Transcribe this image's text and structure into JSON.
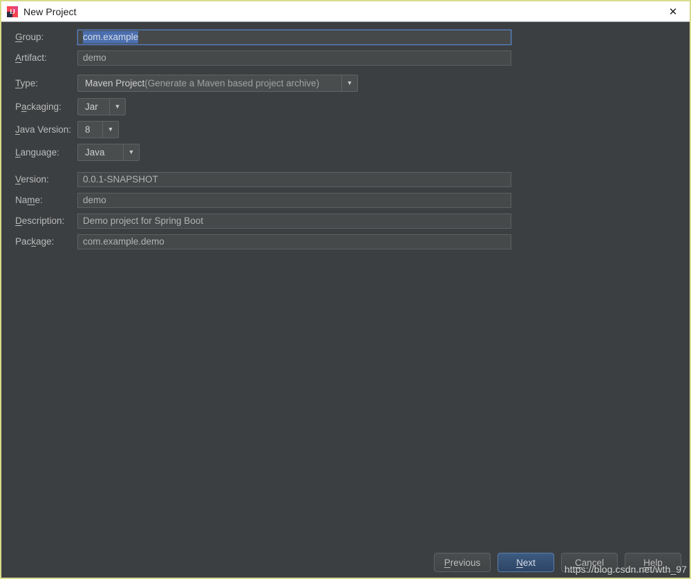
{
  "window": {
    "title": "New Project",
    "icon": "intellij-idea-icon",
    "close_label": "✕",
    "accent_border": "#d9dc8a",
    "panel_bg": "#3c3f41",
    "selection_color": "#4b6eaf",
    "focus_border": "#5781c4"
  },
  "form": {
    "fields": [
      {
        "name": "group",
        "label_pre": "",
        "label_mnemonic": "G",
        "label_post": "roup:",
        "kind": "text",
        "value": "com.example",
        "selected": true,
        "focused": true
      },
      {
        "name": "artifact",
        "label_pre": "",
        "label_mnemonic": "A",
        "label_post": "rtifact:",
        "kind": "text",
        "value": "demo",
        "selected": false,
        "focused": false
      },
      {
        "name": "type",
        "label_pre": "",
        "label_mnemonic": "T",
        "label_post": "ype:",
        "kind": "combo",
        "value": "Maven Project",
        "value_dim": " (Generate a Maven based project archive)",
        "arrow": "▼"
      },
      {
        "name": "packaging",
        "label_pre": "P",
        "label_mnemonic": "a",
        "label_post": "ckaging:",
        "kind": "combo",
        "value": "Jar",
        "value_dim": "",
        "arrow": "▼"
      },
      {
        "name": "java-version",
        "label_pre": "",
        "label_mnemonic": "J",
        "label_post": "ava Version:",
        "kind": "combo",
        "value": "8",
        "value_dim": "",
        "arrow": "▼"
      },
      {
        "name": "language",
        "label_pre": "",
        "label_mnemonic": "L",
        "label_post": "anguage:",
        "kind": "combo",
        "value": "Java",
        "value_dim": "",
        "arrow": "▼"
      },
      {
        "name": "version",
        "label_pre": "",
        "label_mnemonic": "V",
        "label_post": "ersion:",
        "kind": "text",
        "value": "0.0.1-SNAPSHOT",
        "selected": false,
        "focused": false
      },
      {
        "name": "project-name",
        "label_pre": "Na",
        "label_mnemonic": "m",
        "label_post": "e:",
        "kind": "text",
        "value": "demo",
        "selected": false,
        "focused": false
      },
      {
        "name": "description",
        "label_pre": "",
        "label_mnemonic": "D",
        "label_post": "escription:",
        "kind": "text",
        "value": "Demo project for Spring Boot",
        "selected": false,
        "focused": false
      },
      {
        "name": "package",
        "label_pre": "Pac",
        "label_mnemonic": "k",
        "label_post": "age:",
        "kind": "text",
        "value": "com.example.demo",
        "selected": false,
        "focused": false
      }
    ]
  },
  "buttons": [
    {
      "name": "previous",
      "pre": "",
      "mnemonic": "P",
      "post": "revious",
      "primary": false
    },
    {
      "name": "next",
      "pre": "",
      "mnemonic": "N",
      "post": "ext",
      "primary": true
    },
    {
      "name": "cancel",
      "pre": "",
      "mnemonic": "C",
      "post": "ancel",
      "primary": false
    },
    {
      "name": "help",
      "pre": "",
      "mnemonic": "H",
      "post": "elp",
      "primary": false
    }
  ],
  "watermark": {
    "text": "https://blog.csdn.net/wth_97"
  }
}
